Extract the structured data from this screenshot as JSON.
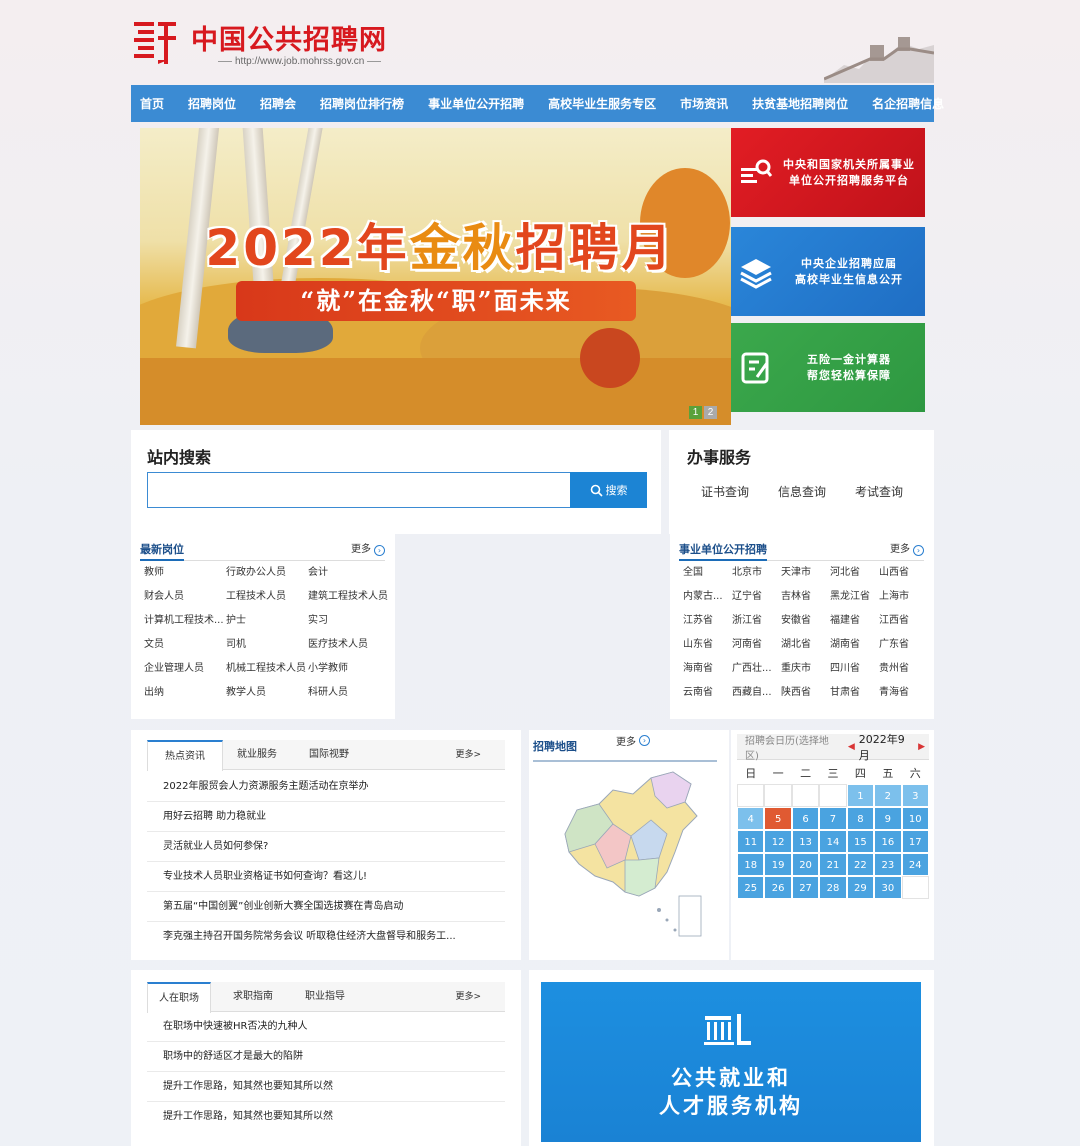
{
  "header": {
    "site_name": "中国公共招聘网",
    "site_url": "http://www.job.mohrss.gov.cn"
  },
  "nav": [
    "首页",
    "招聘岗位",
    "招聘会",
    "招聘岗位排行榜",
    "事业单位公开招聘",
    "高校毕业生服务专区",
    "市场资讯",
    "扶贫基地招聘岗位",
    "名企招聘信息"
  ],
  "banner": {
    "title_year": "2022年",
    "title_gold": "金秋",
    "title_end": "招聘月",
    "subtitle": "“就”在金秋“职”面未来",
    "slides": [
      "1",
      "2"
    ],
    "active_slide": 1
  },
  "promos": {
    "red": [
      "中央和国家机关所属事业",
      "单位公开招聘服务平台"
    ],
    "blue": [
      "中央企业招聘应届",
      "高校毕业生信息公开"
    ],
    "green": [
      "五险一金计算器",
      "帮您轻松算保障"
    ]
  },
  "search": {
    "title": "站内搜索",
    "placeholder": "",
    "button": "搜索"
  },
  "service": {
    "title": "办事服务",
    "links": [
      "证书查询",
      "信息查询",
      "考试查询"
    ]
  },
  "latest_jobs": {
    "title": "最新岗位",
    "more": "更多",
    "items": [
      "教师",
      "行政办公人员",
      "会计",
      "财会人员",
      "工程技术人员",
      "建筑工程技术人员",
      "计算机工程技术...",
      "护士",
      "实习",
      "文员",
      "司机",
      "医疗技术人员",
      "企业管理人员",
      "机械工程技术人员",
      "小学教师",
      "出纳",
      "教学人员",
      "科研人员"
    ]
  },
  "public_recruit": {
    "title": "事业单位公开招聘",
    "more": "更多",
    "items": [
      "全国",
      "北京市",
      "天津市",
      "河北省",
      "山西省",
      "内蒙古...",
      "辽宁省",
      "吉林省",
      "黑龙江省",
      "上海市",
      "江苏省",
      "浙江省",
      "安徽省",
      "福建省",
      "江西省",
      "山东省",
      "河南省",
      "湖北省",
      "湖南省",
      "广东省",
      "海南省",
      "广西壮...",
      "重庆市",
      "四川省",
      "贵州省",
      "云南省",
      "西藏自...",
      "陕西省",
      "甘肃省",
      "青海省"
    ]
  },
  "news": {
    "tabs": [
      "热点资讯",
      "就业服务",
      "国际视野"
    ],
    "more": "更多>",
    "items": [
      "2022年服贸会人力资源服务主题活动在京举办",
      "用好云招聘 助力稳就业",
      "灵活就业人员如何参保?",
      "专业技术人员职业资格证书如何查询？看这儿!",
      "第五届“中国创翼”创业创新大赛全国选拔赛在青岛启动",
      "李克强主持召开国务院常务会议 听取稳住经济大盘督导和服务工..."
    ]
  },
  "map": {
    "title": "招聘地图",
    "more": "更多"
  },
  "calendar": {
    "label": "招聘会日历(选择地区)",
    "month": "2022年9月",
    "weekdays": [
      "日",
      "一",
      "二",
      "三",
      "四",
      "五",
      "六"
    ],
    "highlight_day": 5
  },
  "career": {
    "tabs": [
      "人在职场",
      "求职指南",
      "职业指导"
    ],
    "more": "更多>",
    "items": [
      "在职场中快速被HR否决的九种人",
      "职场中的舒适区才是最大的陷阱",
      "提升工作思路，知其然也要知其所以然",
      "提升工作思路，知其然也要知其所以然"
    ]
  },
  "public_service": {
    "line1": "公共就业和",
    "line2": "人才服务机构"
  },
  "colors": {
    "brand_red": "#d7191f",
    "nav_blue": "#3b8bd3",
    "calendar_blue": "#4aa3e0",
    "calendar_today": "#e05a32"
  },
  "icons": [
    "logo-mark-icon",
    "search-icon",
    "chevron-right-icon",
    "layers-icon",
    "calculator-icon",
    "list-search-icon",
    "building-icon"
  ]
}
